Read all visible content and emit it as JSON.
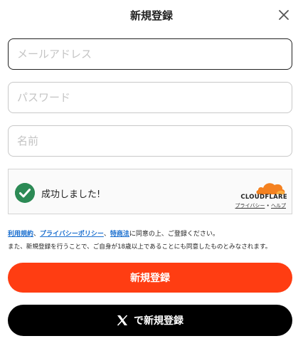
{
  "header": {
    "title": "新規登録",
    "close_icon": "close-icon"
  },
  "form": {
    "email_placeholder": "メールアドレス",
    "password_placeholder": "パスワード",
    "name_placeholder": "名前"
  },
  "captcha": {
    "status": "成功しました!",
    "brand": "CLOUDFLARE",
    "privacy": "プライバシー",
    "separator": "•",
    "help": "ヘルプ",
    "icon": "checkmark-circle-icon",
    "brand_color": "#f48120",
    "check_color": "#2c8a55"
  },
  "terms": {
    "terms_link": "利用規約",
    "sep1": "、",
    "privacy_link": "プライバシーポリシー",
    "sep2": "、",
    "commerce_link": "特商法",
    "suffix": "に同意の上、ご登録ください。",
    "note": "また、新規登録を行うことで、ご自身が18歳以上であることにも同意したものとみなされます。",
    "link_color": "#1b6fcf"
  },
  "buttons": {
    "signup_label": "新規登録",
    "signup_color": "#ff3d12",
    "x_signup_label": "で新規登録",
    "x_icon": "x-logo-icon"
  }
}
